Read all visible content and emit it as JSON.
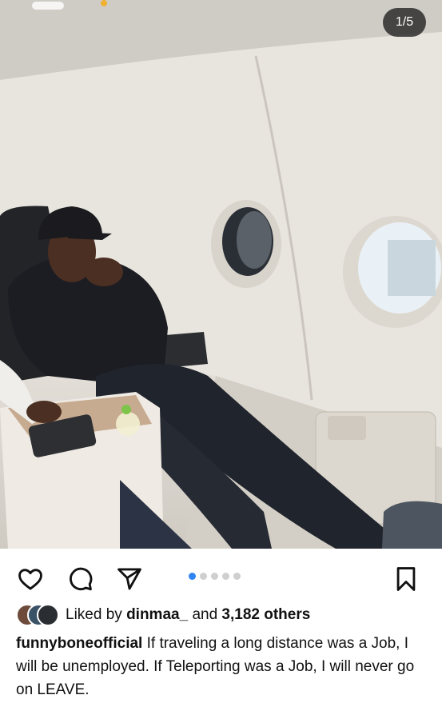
{
  "post": {
    "counter": "1/5",
    "image_alt": "Man seated in airplane seat",
    "carousel": {
      "total": 5,
      "active_index": 0
    },
    "likes": {
      "prefix": "Liked by",
      "user": "dinmaa_",
      "connector": "and",
      "others": "3,182 others"
    },
    "caption": {
      "username": "funnyboneofficial",
      "text": "If traveling a long distance was a Job, I will be unemployed. If Teleporting was a Job, I will never go on LEAVE."
    }
  },
  "icons": {
    "like": "heart-icon",
    "comment": "comment-icon",
    "share": "send-icon",
    "save": "bookmark-icon"
  },
  "colors": {
    "active_dot": "#2f84f0",
    "inactive_dot": "#cfcfcf"
  }
}
